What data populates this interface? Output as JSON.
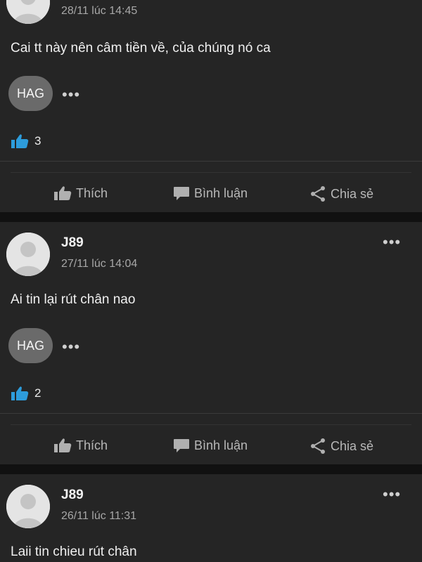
{
  "actions": {
    "like": "Thích",
    "comment": "Bình luận",
    "share": "Chia sẻ"
  },
  "icons": {
    "avatar": "default-avatar-icon",
    "more": "more-dots-icon",
    "like": "thumbs-up-icon",
    "comment": "comment-bubble-icon",
    "share": "share-icon"
  },
  "colors": {
    "background": "#111111",
    "card": "#252525",
    "like_accent": "#2d9cdb",
    "tag": "#6a6a6a"
  },
  "posts": [
    {
      "time": "28/11 lúc 14:45",
      "content": "Cai tt này nên câm tiền về, của chúng nó ca",
      "tag": "HAG",
      "likes": "3"
    },
    {
      "author": "J89",
      "time": "27/11 lúc 14:04",
      "content": "Ai tin lại rút chân nao",
      "tag": "HAG",
      "likes": "2"
    },
    {
      "author": "J89",
      "time": "26/11 lúc 11:31",
      "content": "Laii tin chieu rút chân"
    }
  ]
}
